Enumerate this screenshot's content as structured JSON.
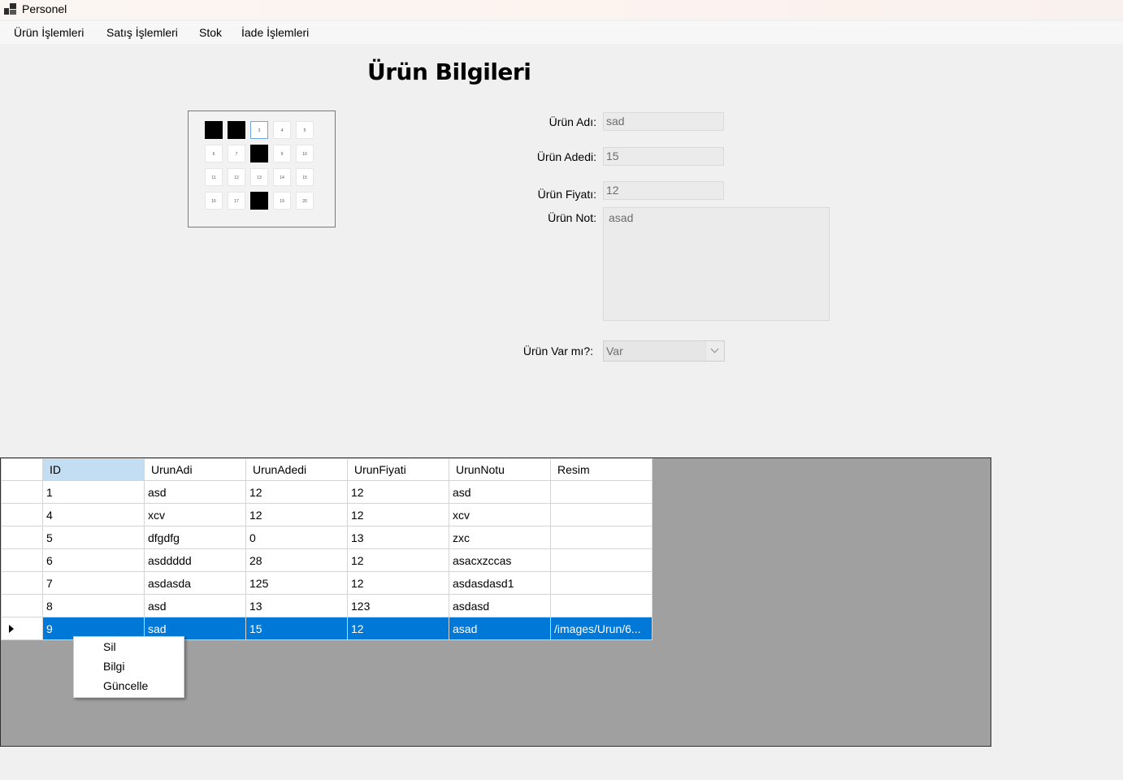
{
  "window": {
    "title": "Personel",
    "icon": "app-window-icon"
  },
  "menu": {
    "items": [
      "Ürün İşlemleri",
      "Satış İşlemleri",
      "Stok",
      "İade İşlemleri"
    ]
  },
  "form": {
    "title": "Ürün Bilgileri",
    "image_cells": [
      "",
      "",
      "3",
      "4",
      "5",
      "6",
      "7",
      "",
      "9",
      "10",
      "11",
      "12",
      "13",
      "14",
      "15",
      "16",
      "17",
      "",
      "19",
      "20"
    ],
    "fields": {
      "urun_adi": {
        "label": "Ürün Adı:",
        "value": "sad"
      },
      "urun_adedi": {
        "label": "Ürün Adedi:",
        "value": "15"
      },
      "urun_fiyati": {
        "label": "Ürün Fiyatı:",
        "value": "12"
      },
      "urun_not": {
        "label": "Ürün Not:",
        "value": "asad"
      },
      "urun_var": {
        "label": "Ürün Var mı?:",
        "value": "Var"
      }
    }
  },
  "grid": {
    "columns": [
      "ID",
      "UrunAdi",
      "UrunAdedi",
      "UrunFiyati",
      "UrunNotu",
      "Resim"
    ],
    "rows": [
      [
        "1",
        "asd",
        "12",
        "12",
        "asd",
        ""
      ],
      [
        "4",
        "xcv",
        "12",
        "12",
        "xcv",
        ""
      ],
      [
        "5",
        "dfgdfg",
        "0",
        "13",
        "zxc",
        ""
      ],
      [
        "6",
        "asddddd",
        "28",
        "12",
        "asacxzccas",
        ""
      ],
      [
        "7",
        "asdasda",
        "125",
        "12",
        "asdasdasd1",
        ""
      ],
      [
        "8",
        "asd",
        "13",
        "123",
        "asdasd",
        ""
      ],
      [
        "9",
        "sad",
        "15",
        "12",
        "asad",
        "/images/Urun/6..."
      ]
    ],
    "selected_row": 6
  },
  "context_menu": {
    "items": [
      "Sil",
      "Bilgi",
      "Güncelle"
    ]
  },
  "colors": {
    "selection": "#0078d7",
    "header_highlight": "#c3ddf3",
    "grid_background": "#a0a0a0",
    "form_background": "#f0f0f0"
  }
}
